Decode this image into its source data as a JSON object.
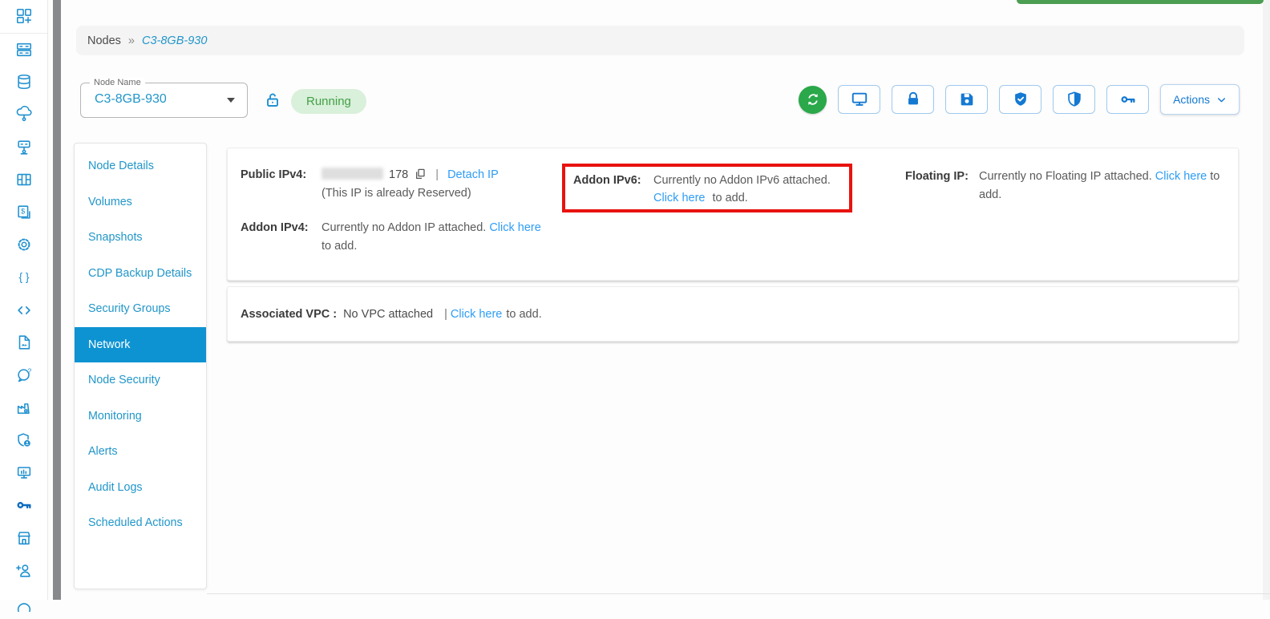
{
  "colors": {
    "accent_blue": "#1479d2",
    "rail_icon_blue": "#2191d0",
    "nav_link_blue": "#2196c9",
    "nav_selected_bg": "#0e93d2",
    "link_blue": "#2e9df5",
    "running_badge_bg": "#d9f0da",
    "running_badge_text": "#43a047",
    "refresh_green": "#2aa84a",
    "toast_green": "#4c9e52",
    "annotation_red": "#e8120f"
  },
  "sidebar": {
    "icons": [
      "dashboard",
      "nodes",
      "database",
      "cloud-network",
      "server-network",
      "containers",
      "billing",
      "settings",
      "json-braces",
      "code",
      "image-file",
      "support-chat",
      "factory",
      "shield-user",
      "monitor-chart",
      "ssh-key",
      "marketplace",
      "add-user",
      "more-partial"
    ]
  },
  "breadcrumb": {
    "root": "Nodes",
    "separator": "»",
    "current": "C3-8GB-930"
  },
  "header": {
    "node_name_label": "Node Name",
    "node_name_value": "C3-8GB-930",
    "status_badge": "Running",
    "actions_label": "Actions",
    "toolbar_icons": [
      "refresh",
      "console",
      "lock",
      "save",
      "security-check",
      "security-shield",
      "ssh-key"
    ]
  },
  "nav": {
    "selected": "Network",
    "items": [
      "Node Details",
      "Volumes",
      "Snapshots",
      "CDP Backup Details",
      "Security Groups",
      "Network",
      "Node Security",
      "Monitoring",
      "Alerts",
      "Audit Logs",
      "Scheduled Actions"
    ]
  },
  "network": {
    "public_ipv4": {
      "label": "Public IPv4:",
      "ip_visible_suffix": "178",
      "separator": "|",
      "detach_link": "Detach IP",
      "reserved_note": "(This IP is already Reserved)"
    },
    "addon_ipv4": {
      "label": "Addon IPv4:",
      "message": "Currently no Addon IP attached.",
      "link": "Click here",
      "link_suffix": "to add."
    },
    "addon_ipv6": {
      "label": "Addon IPv6:",
      "message": "Currently no Addon IPv6 attached.",
      "link": "Click here",
      "link_suffix": "to add."
    },
    "floating_ip": {
      "label": "Floating IP:",
      "message": "Currently no Floating IP attached.",
      "link": "Click here",
      "link_suffix": "to add."
    }
  },
  "vpc": {
    "label": "Associated VPC :",
    "value": "No VPC attached",
    "separator": "|",
    "link": "Click here",
    "link_suffix": "to add."
  }
}
